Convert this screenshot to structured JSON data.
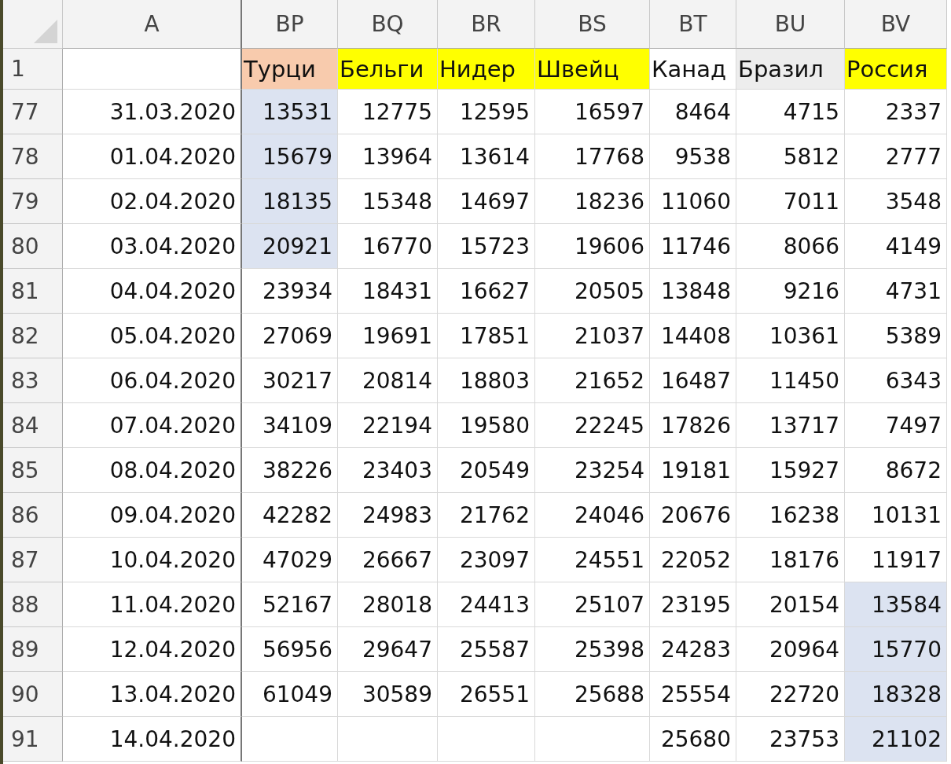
{
  "column_headers": [
    "A",
    "BP",
    "BQ",
    "BR",
    "BS",
    "BT",
    "BU",
    "BV"
  ],
  "header_row": {
    "row": "1",
    "cells": [
      {
        "text": "Турци",
        "color": "#f8cbad"
      },
      {
        "text": "Бельги",
        "color": "#ffff00"
      },
      {
        "text": "Нидер",
        "color": "#ffff00"
      },
      {
        "text": "Швейц",
        "color": "#ffff00"
      },
      {
        "text": "Канад",
        "color": "#ffffff"
      },
      {
        "text": "Бразил",
        "color": "#ededed"
      },
      {
        "text": "Россия",
        "color": "#ffff00"
      }
    ]
  },
  "rows": [
    {
      "row": "77",
      "date": "31.03.2020",
      "cells": [
        {
          "text": "13531",
          "highlighted": true
        },
        {
          "text": "12775",
          "highlighted": false
        },
        {
          "text": "12595",
          "highlighted": false
        },
        {
          "text": "16597",
          "highlighted": false
        },
        {
          "text": "8464",
          "highlighted": false
        },
        {
          "text": "4715",
          "highlighted": false
        },
        {
          "text": "2337",
          "highlighted": false
        }
      ]
    },
    {
      "row": "78",
      "date": "01.04.2020",
      "cells": [
        {
          "text": "15679",
          "highlighted": true
        },
        {
          "text": "13964",
          "highlighted": false
        },
        {
          "text": "13614",
          "highlighted": false
        },
        {
          "text": "17768",
          "highlighted": false
        },
        {
          "text": "9538",
          "highlighted": false
        },
        {
          "text": "5812",
          "highlighted": false
        },
        {
          "text": "2777",
          "highlighted": false
        }
      ]
    },
    {
      "row": "79",
      "date": "02.04.2020",
      "cells": [
        {
          "text": "18135",
          "highlighted": true
        },
        {
          "text": "15348",
          "highlighted": false
        },
        {
          "text": "14697",
          "highlighted": false
        },
        {
          "text": "18236",
          "highlighted": false
        },
        {
          "text": "11060",
          "highlighted": false
        },
        {
          "text": "7011",
          "highlighted": false
        },
        {
          "text": "3548",
          "highlighted": false
        }
      ]
    },
    {
      "row": "80",
      "date": "03.04.2020",
      "cells": [
        {
          "text": "20921",
          "highlighted": true
        },
        {
          "text": "16770",
          "highlighted": false
        },
        {
          "text": "15723",
          "highlighted": false
        },
        {
          "text": "19606",
          "highlighted": false
        },
        {
          "text": "11746",
          "highlighted": false
        },
        {
          "text": "8066",
          "highlighted": false
        },
        {
          "text": "4149",
          "highlighted": false
        }
      ]
    },
    {
      "row": "81",
      "date": "04.04.2020",
      "cells": [
        {
          "text": "23934",
          "highlighted": false
        },
        {
          "text": "18431",
          "highlighted": false
        },
        {
          "text": "16627",
          "highlighted": false
        },
        {
          "text": "20505",
          "highlighted": false
        },
        {
          "text": "13848",
          "highlighted": false
        },
        {
          "text": "9216",
          "highlighted": false
        },
        {
          "text": "4731",
          "highlighted": false
        }
      ]
    },
    {
      "row": "82",
      "date": "05.04.2020",
      "cells": [
        {
          "text": "27069",
          "highlighted": false
        },
        {
          "text": "19691",
          "highlighted": false
        },
        {
          "text": "17851",
          "highlighted": false
        },
        {
          "text": "21037",
          "highlighted": false
        },
        {
          "text": "14408",
          "highlighted": false
        },
        {
          "text": "10361",
          "highlighted": false
        },
        {
          "text": "5389",
          "highlighted": false
        }
      ]
    },
    {
      "row": "83",
      "date": "06.04.2020",
      "cells": [
        {
          "text": "30217",
          "highlighted": false
        },
        {
          "text": "20814",
          "highlighted": false
        },
        {
          "text": "18803",
          "highlighted": false
        },
        {
          "text": "21652",
          "highlighted": false
        },
        {
          "text": "16487",
          "highlighted": false
        },
        {
          "text": "11450",
          "highlighted": false
        },
        {
          "text": "6343",
          "highlighted": false
        }
      ]
    },
    {
      "row": "84",
      "date": "07.04.2020",
      "cells": [
        {
          "text": "34109",
          "highlighted": false
        },
        {
          "text": "22194",
          "highlighted": false
        },
        {
          "text": "19580",
          "highlighted": false
        },
        {
          "text": "22245",
          "highlighted": false
        },
        {
          "text": "17826",
          "highlighted": false
        },
        {
          "text": "13717",
          "highlighted": false
        },
        {
          "text": "7497",
          "highlighted": false
        }
      ]
    },
    {
      "row": "85",
      "date": "08.04.2020",
      "cells": [
        {
          "text": "38226",
          "highlighted": false
        },
        {
          "text": "23403",
          "highlighted": false
        },
        {
          "text": "20549",
          "highlighted": false
        },
        {
          "text": "23254",
          "highlighted": false
        },
        {
          "text": "19181",
          "highlighted": false
        },
        {
          "text": "15927",
          "highlighted": false
        },
        {
          "text": "8672",
          "highlighted": false
        }
      ]
    },
    {
      "row": "86",
      "date": "09.04.2020",
      "cells": [
        {
          "text": "42282",
          "highlighted": false
        },
        {
          "text": "24983",
          "highlighted": false
        },
        {
          "text": "21762",
          "highlighted": false
        },
        {
          "text": "24046",
          "highlighted": false
        },
        {
          "text": "20676",
          "highlighted": false
        },
        {
          "text": "16238",
          "highlighted": false
        },
        {
          "text": "10131",
          "highlighted": false
        }
      ]
    },
    {
      "row": "87",
      "date": "10.04.2020",
      "cells": [
        {
          "text": "47029",
          "highlighted": false
        },
        {
          "text": "26667",
          "highlighted": false
        },
        {
          "text": "23097",
          "highlighted": false
        },
        {
          "text": "24551",
          "highlighted": false
        },
        {
          "text": "22052",
          "highlighted": false
        },
        {
          "text": "18176",
          "highlighted": false
        },
        {
          "text": "11917",
          "highlighted": false
        }
      ]
    },
    {
      "row": "88",
      "date": "11.04.2020",
      "cells": [
        {
          "text": "52167",
          "highlighted": false
        },
        {
          "text": "28018",
          "highlighted": false
        },
        {
          "text": "24413",
          "highlighted": false
        },
        {
          "text": "25107",
          "highlighted": false
        },
        {
          "text": "23195",
          "highlighted": false
        },
        {
          "text": "20154",
          "highlighted": false
        },
        {
          "text": "13584",
          "highlighted": true
        }
      ]
    },
    {
      "row": "89",
      "date": "12.04.2020",
      "cells": [
        {
          "text": "56956",
          "highlighted": false
        },
        {
          "text": "29647",
          "highlighted": false
        },
        {
          "text": "25587",
          "highlighted": false
        },
        {
          "text": "25398",
          "highlighted": false
        },
        {
          "text": "24283",
          "highlighted": false
        },
        {
          "text": "20964",
          "highlighted": false
        },
        {
          "text": "15770",
          "highlighted": true
        }
      ]
    },
    {
      "row": "90",
      "date": "13.04.2020",
      "cells": [
        {
          "text": "61049",
          "highlighted": false
        },
        {
          "text": "30589",
          "highlighted": false
        },
        {
          "text": "26551",
          "highlighted": false
        },
        {
          "text": "25688",
          "highlighted": false
        },
        {
          "text": "25554",
          "highlighted": false
        },
        {
          "text": "22720",
          "highlighted": false
        },
        {
          "text": "18328",
          "highlighted": true
        }
      ]
    },
    {
      "row": "91",
      "date": "14.04.2020",
      "cells": [
        {
          "highlighted": false
        },
        {
          "highlighted": false
        },
        {
          "highlighted": false
        },
        {
          "highlighted": false
        },
        {
          "text": "25680",
          "highlighted": false
        },
        {
          "text": "23753",
          "highlighted": false
        },
        {
          "text": "21102",
          "highlighted": true
        }
      ]
    }
  ]
}
